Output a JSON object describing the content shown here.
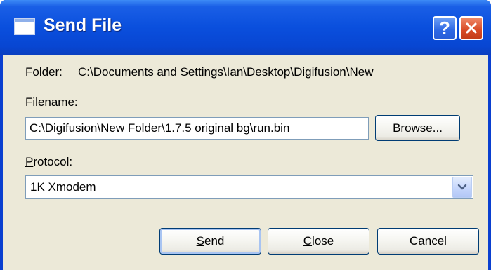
{
  "window": {
    "title": "Send File",
    "help_button": "?"
  },
  "folder": {
    "label": "Folder:",
    "path": "C:\\Documents and Settings\\Ian\\Desktop\\Digifusion\\New"
  },
  "filename": {
    "label": "Filename:",
    "value": "C:\\Digifusion\\New Folder\\1.7.5 original bg\\run.bin",
    "browse_button": "Browse..."
  },
  "protocol": {
    "label": "Protocol:",
    "selected": "1K Xmodem"
  },
  "buttons": {
    "send": "Send",
    "close": "Close",
    "cancel": "Cancel"
  },
  "icons": {
    "title": "window-icon",
    "help": "question-mark-icon",
    "close": "x-icon",
    "dropdown": "chevron-down-icon"
  },
  "colors": {
    "titlebar": "#0a4fdd",
    "dialog_background": "#ece9d8",
    "close_button": "#d84a25",
    "field_border": "#7f9db9",
    "button_border": "#003c74"
  }
}
